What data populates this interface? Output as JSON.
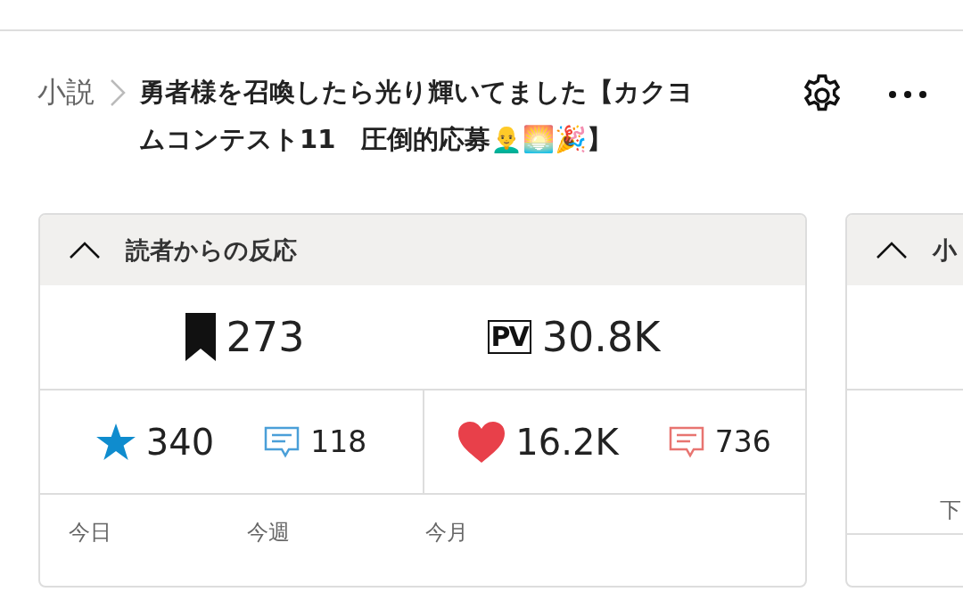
{
  "breadcrumb": {
    "section": "小説",
    "title": "勇者様を召喚したら光り輝いてました【カクヨムコンテスト11　圧倒的応募👨‍🦲🌅🎉】"
  },
  "panels": [
    {
      "title": "読者からの反応",
      "expanded": true,
      "headline": [
        {
          "kind": "bookmark",
          "value": "273"
        },
        {
          "kind": "pv",
          "icon_text": "PV",
          "value": "30.8K"
        }
      ],
      "groups": [
        {
          "items": [
            {
              "kind": "star",
              "value": "340"
            },
            {
              "kind": "comment",
              "color": "#4a9fd8",
              "value": "118"
            }
          ]
        },
        {
          "items": [
            {
              "kind": "heart",
              "value": "16.2K"
            },
            {
              "kind": "comment",
              "color": "#e87470",
              "value": "736"
            }
          ]
        }
      ],
      "periods": [
        "今日",
        "今週",
        "今月"
      ]
    },
    {
      "title": "小",
      "expanded": true,
      "note": "下"
    }
  ]
}
